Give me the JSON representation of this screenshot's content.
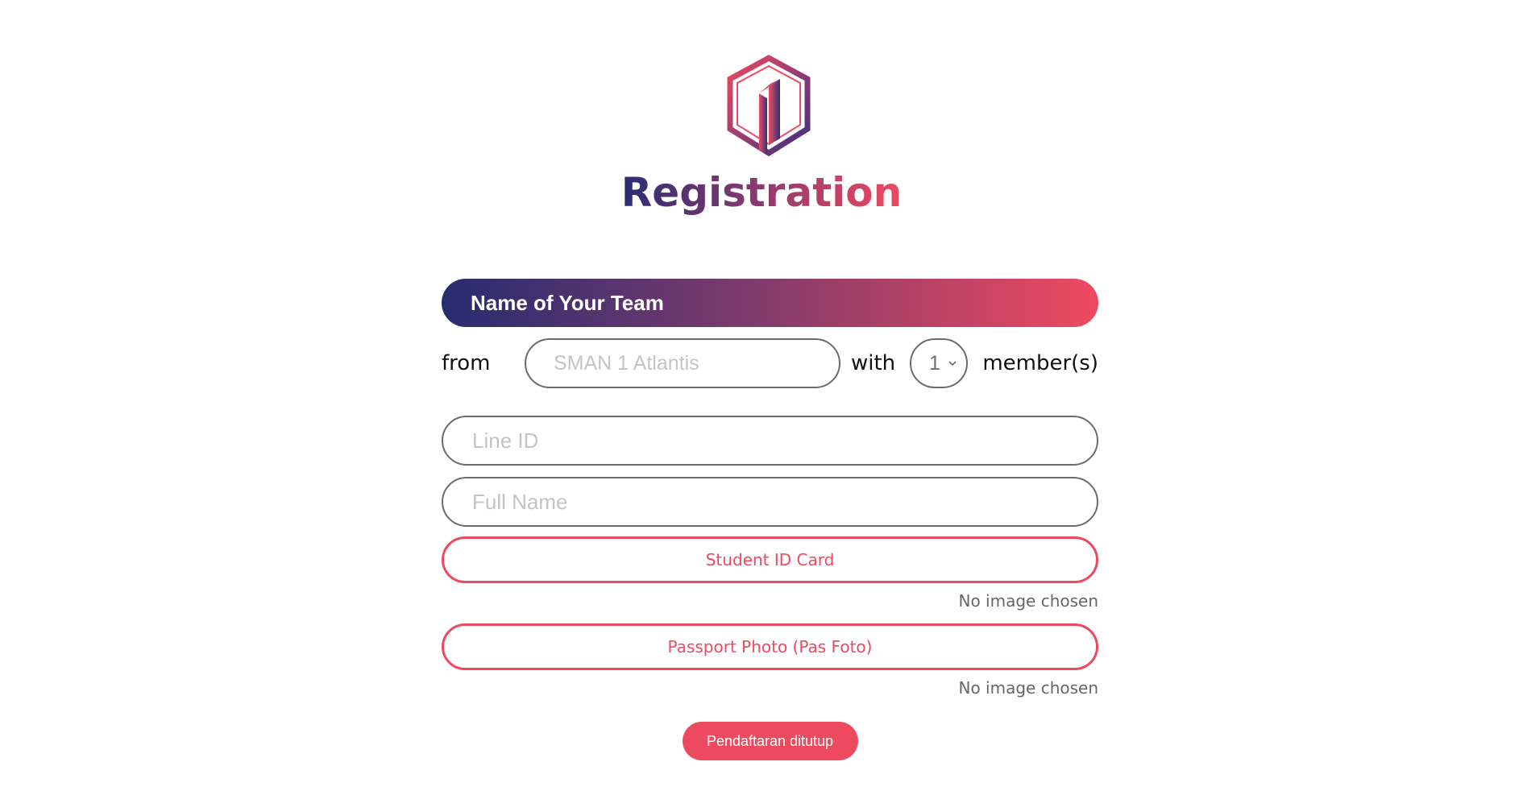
{
  "header": {
    "logo_icon": "hexagon-logo-icon",
    "title": "Registration",
    "gradient_start": "#2a2c72",
    "gradient_end": "#ee4a5f"
  },
  "form": {
    "team_name": {
      "placeholder": "Name of Your Team",
      "value": ""
    },
    "school": {
      "from_label": "from",
      "placeholder": "SMAN 1 Atlantis",
      "value": "",
      "with_label": "with",
      "member_count": "1",
      "members_label": "member(s)"
    },
    "line_id": {
      "placeholder": "Line ID",
      "value": ""
    },
    "full_name": {
      "placeholder": "Full Name",
      "value": ""
    },
    "student_id_card": {
      "label": "Student ID Card",
      "status": "No image chosen"
    },
    "passport_photo": {
      "label": "Passport Photo (Pas Foto)",
      "status": "No image chosen"
    },
    "submit": {
      "label": "Pendaftaran ditutup"
    }
  },
  "colors": {
    "accent": "#ee4a5f",
    "border": "#6b6b6b",
    "placeholder": "#c4c4c4"
  }
}
